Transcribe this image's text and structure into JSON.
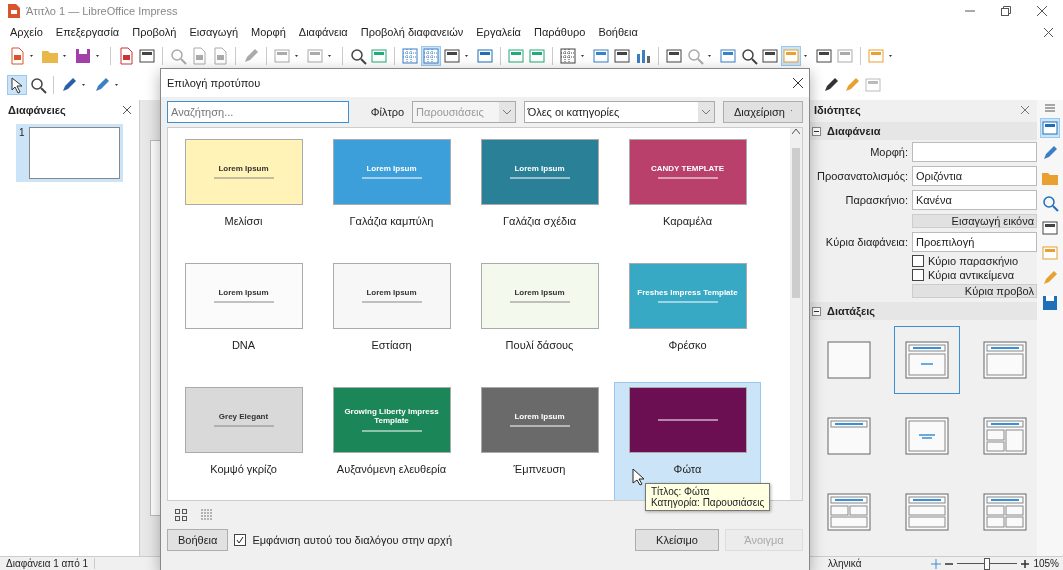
{
  "window": {
    "title": "Άτιτλο 1 — LibreOffice Impress"
  },
  "menu": [
    "Αρχείο",
    "Επεξεργασία",
    "Προβολή",
    "Εισαγωγή",
    "Μορφή",
    "Διαφάνεια",
    "Προβολή διαφανειών",
    "Εργαλεία",
    "Παράθυρο",
    "Βοήθεια"
  ],
  "slides_panel": {
    "title": "Διαφάνειες",
    "slides": [
      {
        "number": "1",
        "selected": true
      }
    ]
  },
  "dialog": {
    "title": "Επιλογή προτύπου",
    "search": {
      "placeholder": "Αναζήτηση..."
    },
    "filter_label": "Φίλτρο",
    "filter": {
      "value": "Παρουσιάσεις",
      "disabled": true
    },
    "category": {
      "value": "Όλες οι κατηγορίες"
    },
    "manage_button": "Διαχείριση",
    "templates": [
      {
        "name": "Μελίσσι",
        "preview_title": "Lorem Ipsum",
        "color": "#fff3b8",
        "selected": false
      },
      {
        "name": "Γαλάζια καμπύλη",
        "preview_title": "Lorem Ipsum",
        "color": "#3d9fd9",
        "selected": false
      },
      {
        "name": "Γαλάζια σχέδια",
        "preview_title": "Lorem Ipsum",
        "color": "#2a8097",
        "selected": false
      },
      {
        "name": "Καραμέλα",
        "preview_title": "CANDY TEMPLATE",
        "color": "#b8406a",
        "selected": false
      },
      {
        "name": "DNA",
        "preview_title": "Lorem Ipsum",
        "color": "#fbfbfb",
        "selected": false
      },
      {
        "name": "Εστίαση",
        "preview_title": "Lorem Ipsum",
        "color": "#f7f7f7",
        "selected": false
      },
      {
        "name": "Πουλί δάσους",
        "preview_title": "Lorem Ipsum",
        "color": "#f4f9ee",
        "selected": false
      },
      {
        "name": "Φρέσκο",
        "preview_title": "Freshes Impress Template",
        "color": "#37a9c4",
        "selected": false
      },
      {
        "name": "Κομψό γκρίζο",
        "preview_title": "Grey Elegant",
        "color": "#d9d9d9",
        "selected": false
      },
      {
        "name": "Αυξανόμενη ελευθερία",
        "preview_title": "Growing Liberty Impress Template",
        "color": "#1b8658",
        "selected": false
      },
      {
        "name": "Έμπνευση",
        "preview_title": "Lorem Ipsum",
        "color": "#6a6a6a",
        "selected": false
      },
      {
        "name": "Φώτα",
        "color": "#6b0f52",
        "selected": true
      }
    ],
    "tooltip": [
      "Τίτλος: Φώτα",
      "Κατηγορία: Παρουσιάσεις"
    ],
    "help_button": "Βοήθεια",
    "show_on_start": {
      "label": "Εμφάνιση αυτού του διαλόγου στην αρχή",
      "checked": true
    },
    "close_button": "Κλείσιμο",
    "open_button": {
      "label": "Άνοιγμα",
      "disabled": true
    }
  },
  "properties": {
    "title": "Ιδιότητες",
    "slide_section": {
      "title": "Διαφάνεια",
      "expanded": true,
      "fields": [
        {
          "label": "Μορφή:"
        },
        {
          "label": "Προσανατολισμός:",
          "value": "Οριζόντια"
        },
        {
          "label": "Παρασκήνιο:",
          "value": "Κανένα"
        }
      ],
      "insert_image_button": "Εισαγωγή εικόνα",
      "master_label": "Κύρια διαφάνεια:",
      "master_value": "Προεπιλογή",
      "checkboxes": [
        {
          "label": "Κύριο παρασκήνιο",
          "checked": false
        },
        {
          "label": "Κύρια αντικείμενα",
          "checked": false
        }
      ],
      "master_view_button": "Κύρια προβολ"
    },
    "layouts_section": {
      "title": "Διατάξεις",
      "expanded": true,
      "layouts": [
        {
          "kind": "blank",
          "selected": false
        },
        {
          "kind": "title-subtitle",
          "selected": true
        },
        {
          "kind": "title-content",
          "selected": false
        },
        {
          "kind": "title-only",
          "selected": false
        },
        {
          "kind": "centered-text",
          "selected": false
        },
        {
          "kind": "title-2-left-1-right",
          "selected": false
        },
        {
          "kind": "title-2-top-1-bottom",
          "selected": false
        },
        {
          "kind": "title-2-rows",
          "selected": false
        },
        {
          "kind": "title-4-boxes",
          "selected": false
        }
      ]
    }
  },
  "status_bar": {
    "slide_info": "Διαφάνεια 1 από 1",
    "language": "λληνικά",
    "zoom": {
      "level": 0.5,
      "reading": "105%"
    }
  }
}
